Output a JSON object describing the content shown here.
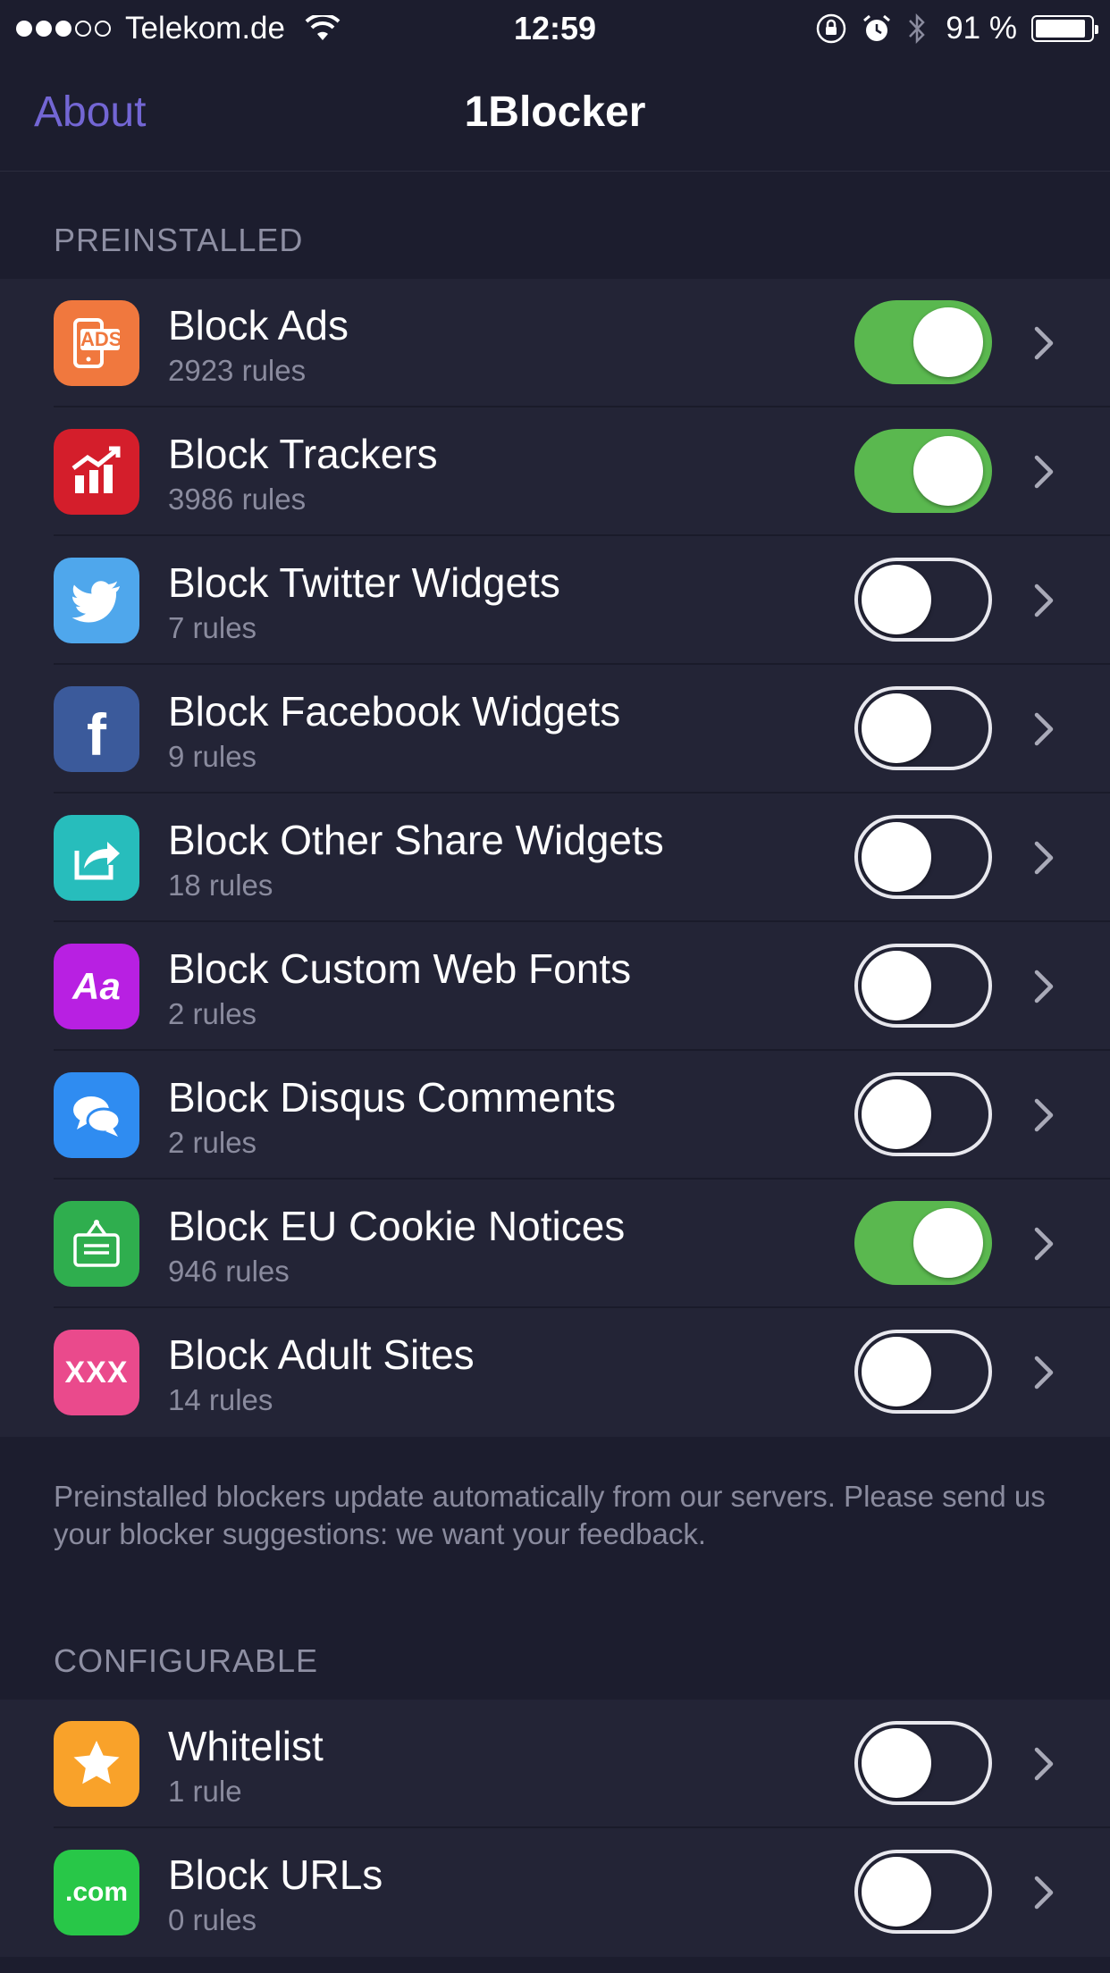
{
  "status_bar": {
    "carrier": "Telekom.de",
    "time": "12:59",
    "battery_percent": "91 %",
    "battery_level": 0.91,
    "signal_bars_filled": 3,
    "signal_bars_total": 5
  },
  "nav": {
    "back_label": "About",
    "title": "1Blocker"
  },
  "colors": {
    "accent": "#7366d4",
    "toggle_on": "#5ab84f",
    "background": "#1c1d2e",
    "cell": "#232436"
  },
  "preinstalled": {
    "header": "PREINSTALLED",
    "items": [
      {
        "title": "Block Ads",
        "subtitle": "2923 rules",
        "enabled": true,
        "icon": "ads-icon",
        "icon_color": "#f0783e",
        "icon_text": "ADS"
      },
      {
        "title": "Block Trackers",
        "subtitle": "3986 rules",
        "enabled": true,
        "icon": "trackers-chart-icon",
        "icon_color": "#d41e2b"
      },
      {
        "title": "Block Twitter Widgets",
        "subtitle": "7 rules",
        "enabled": false,
        "icon": "twitter-bird-icon",
        "icon_color": "#4fa7ec"
      },
      {
        "title": "Block Facebook Widgets",
        "subtitle": "9 rules",
        "enabled": false,
        "icon": "facebook-icon",
        "icon_color": "#3b5a9b",
        "icon_text": "f"
      },
      {
        "title": "Block Other Share Widgets",
        "subtitle": "18 rules",
        "enabled": false,
        "icon": "share-icon",
        "icon_color": "#27bdbc"
      },
      {
        "title": "Block Custom Web Fonts",
        "subtitle": "2 rules",
        "enabled": false,
        "icon": "font-icon",
        "icon_color": "#b820e2",
        "icon_text": "Aa"
      },
      {
        "title": "Block Disqus Comments",
        "subtitle": "2 rules",
        "enabled": false,
        "icon": "comments-icon",
        "icon_color": "#2f8cf1"
      },
      {
        "title": "Block EU Cookie Notices",
        "subtitle": "946 rules",
        "enabled": true,
        "icon": "cookie-sign-icon",
        "icon_color": "#2fae4e"
      },
      {
        "title": "Block Adult Sites",
        "subtitle": "14 rules",
        "enabled": false,
        "icon": "adult-icon",
        "icon_color": "#ea4a8c",
        "icon_text": "XXX"
      }
    ],
    "footer": "Preinstalled blockers update automatically from our servers. Please send us your blocker suggestions: we want your feedback."
  },
  "configurable": {
    "header": "CONFIGURABLE",
    "items": [
      {
        "title": "Whitelist",
        "subtitle": "1 rule",
        "enabled": false,
        "icon": "star-icon",
        "icon_color": "#f9a22a"
      },
      {
        "title": "Block URLs",
        "subtitle": "0 rules",
        "enabled": false,
        "icon": "dotcom-icon",
        "icon_color": "#28c748",
        "icon_text": ".com"
      }
    ]
  }
}
